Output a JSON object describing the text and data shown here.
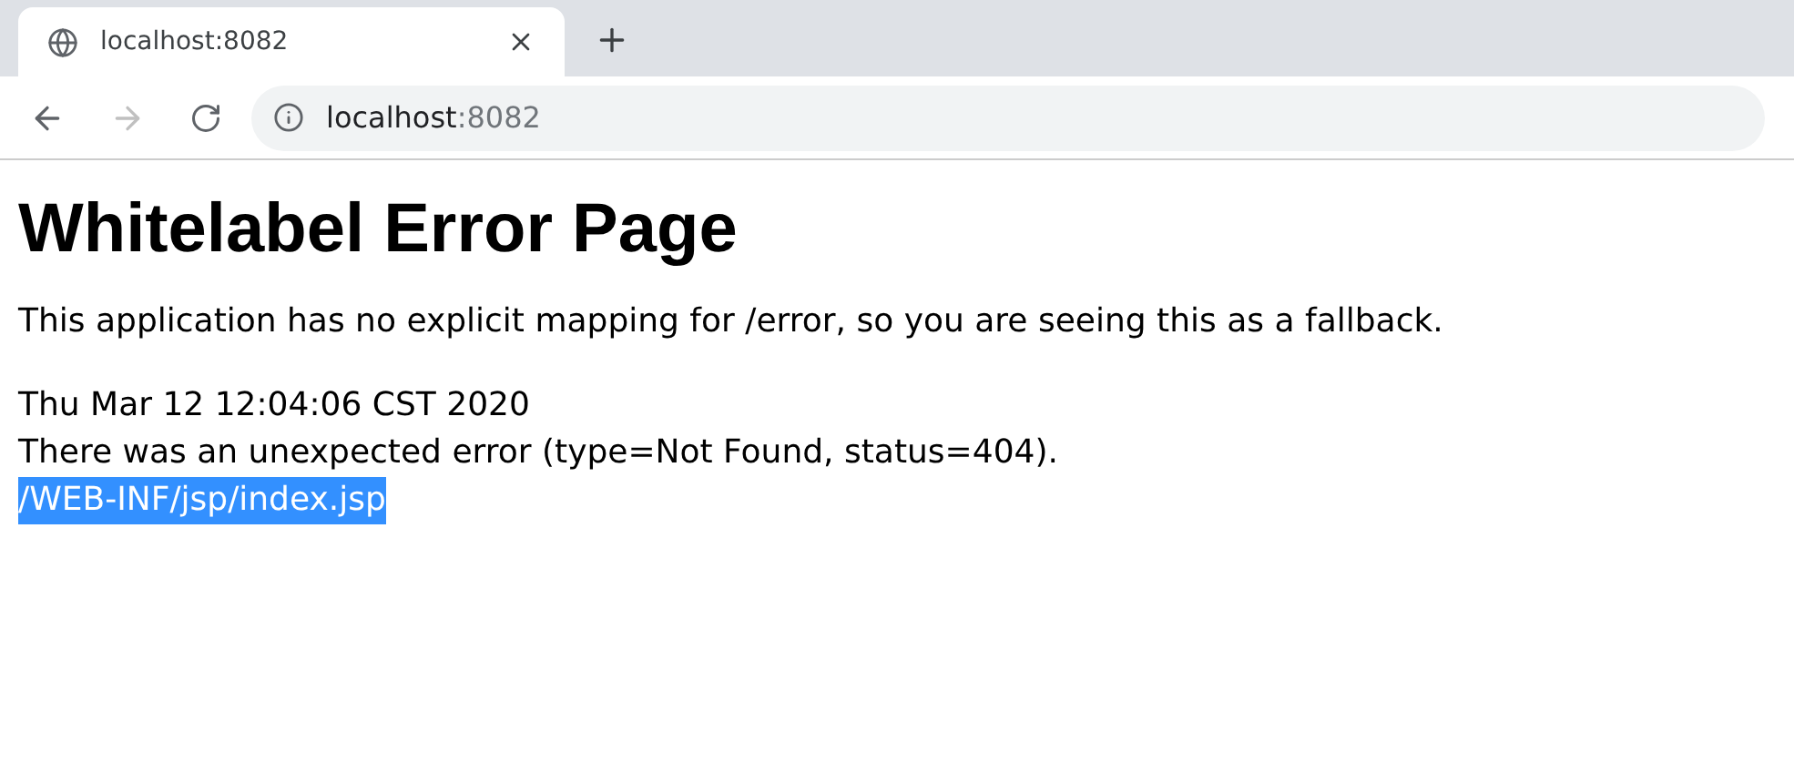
{
  "tab": {
    "title": "localhost:8082",
    "selected": true
  },
  "address_bar": {
    "host": "localhost",
    "port": ":8082"
  },
  "nav": {
    "back_disabled": false,
    "forward_disabled": true
  },
  "page": {
    "heading": "Whitelabel Error Page",
    "paragraph": "This application has no explicit mapping for /error, so you are seeing this as a fallback.",
    "lines": [
      {
        "text": "Thu Mar 12 12:04:06 CST 2020",
        "highlighted": false
      },
      {
        "text": "There was an unexpected error (type=Not Found, status=404).",
        "highlighted": false
      },
      {
        "text": "/WEB-INF/jsp/index.jsp",
        "highlighted": true
      }
    ]
  }
}
